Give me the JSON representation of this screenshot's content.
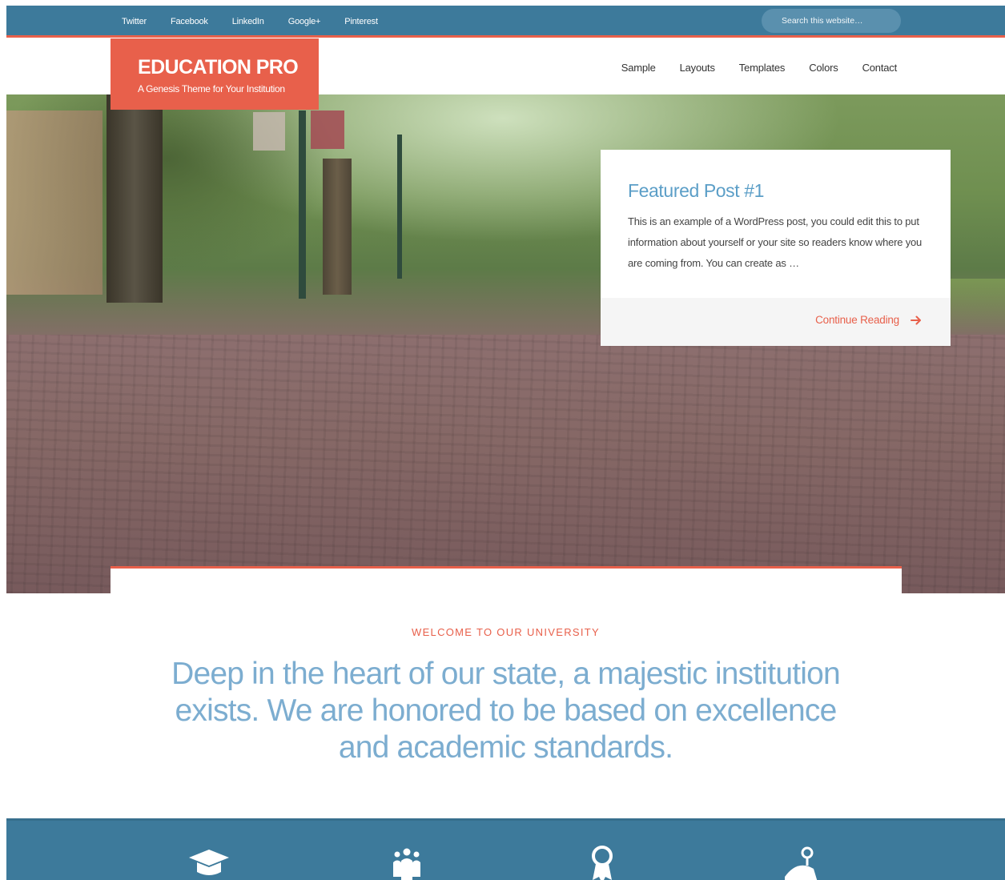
{
  "topbar": {
    "social_links": [
      "Twitter",
      "Facebook",
      "LinkedIn",
      "Google+",
      "Pinterest"
    ],
    "search_placeholder": "Search this website…"
  },
  "header": {
    "site_title": "EDUCATION PRO",
    "site_tagline": "A Genesis Theme for Your Institution",
    "nav": [
      "Sample",
      "Layouts",
      "Templates",
      "Colors",
      "Contact"
    ]
  },
  "featured": {
    "title": "Featured Post #1",
    "excerpt": "This is an example of a WordPress post, you could edit this to put information about yourself or your site so readers know where you are coming from. You can create as …",
    "more_label": "Continue Reading"
  },
  "welcome": {
    "label": "WELCOME TO OUR UNIVERSITY",
    "text": "Deep in the heart of our state, a majestic institution exists. We are honored to be based on excellence and academic standards."
  },
  "features": {
    "icons": [
      "graduation-cap-icon",
      "people-group-icon",
      "award-badge-icon",
      "location-pin-icon"
    ]
  },
  "colors": {
    "accent": "#e8604b",
    "primary": "#3d7a9b",
    "headline": "#7cadd0"
  }
}
